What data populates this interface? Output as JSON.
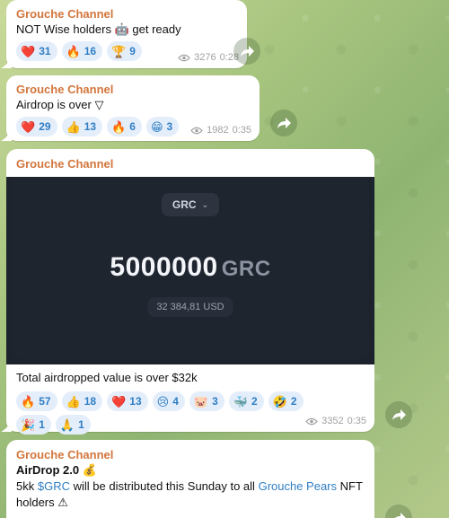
{
  "messages": [
    {
      "sender": "Grouche Channel",
      "text": "NOT Wise holders",
      "text_emoji": "🤖",
      "text_suffix": "get ready",
      "reactions": [
        {
          "emoji": "❤️",
          "count": "31"
        },
        {
          "emoji": "🔥",
          "count": "16"
        },
        {
          "emoji": "🏆",
          "count": "9"
        }
      ],
      "views": "3276",
      "time": "0:28"
    },
    {
      "sender": "Grouche Channel",
      "text": "Airdrop is over",
      "text_emoji": "▽",
      "reactions": [
        {
          "emoji": "❤️",
          "count": "29"
        },
        {
          "emoji": "👍",
          "count": "13"
        },
        {
          "emoji": "🔥",
          "count": "6"
        },
        {
          "emoji": "😁",
          "count": "3"
        }
      ],
      "views": "1982",
      "time": "0:35"
    },
    {
      "sender": "Grouche Channel",
      "media": {
        "token": "GRC",
        "amount": "5000000",
        "amount_unit": "GRC",
        "usd": "32 384,81 USD"
      },
      "text": "Total airdropped value is over $32k",
      "reactions": [
        {
          "emoji": "🔥",
          "count": "57"
        },
        {
          "emoji": "👍",
          "count": "18"
        },
        {
          "emoji": "❤️",
          "count": "13"
        },
        {
          "emoji": "😢",
          "count": "4"
        },
        {
          "emoji": "🐷",
          "count": "3"
        },
        {
          "emoji": "🐳",
          "count": "2"
        },
        {
          "emoji": "🤣",
          "count": "2"
        },
        {
          "emoji": "🎉",
          "count": "1"
        },
        {
          "emoji": "🙏",
          "count": "1"
        }
      ],
      "views": "3352",
      "time": "0:35"
    },
    {
      "sender": "Grouche Channel",
      "title": "AirDrop 2.0",
      "title_emoji": "💰",
      "body_prefix": "5kk",
      "body_link1": "$GRC",
      "body_mid": "will be distributed this Sunday to all",
      "body_link2": "Grouche Pears",
      "body_suffix": "NFT holders",
      "body_emoji": "⚠"
    }
  ],
  "colors": {
    "sender": "#d2763c",
    "reaction_text": "#2f7ec4",
    "reaction_bg": "#e4eefb",
    "link": "#2f7ec4"
  },
  "icons": {
    "share": "share-arrow-icon",
    "views": "eye-icon",
    "dropdown": "chevron-down-icon"
  }
}
